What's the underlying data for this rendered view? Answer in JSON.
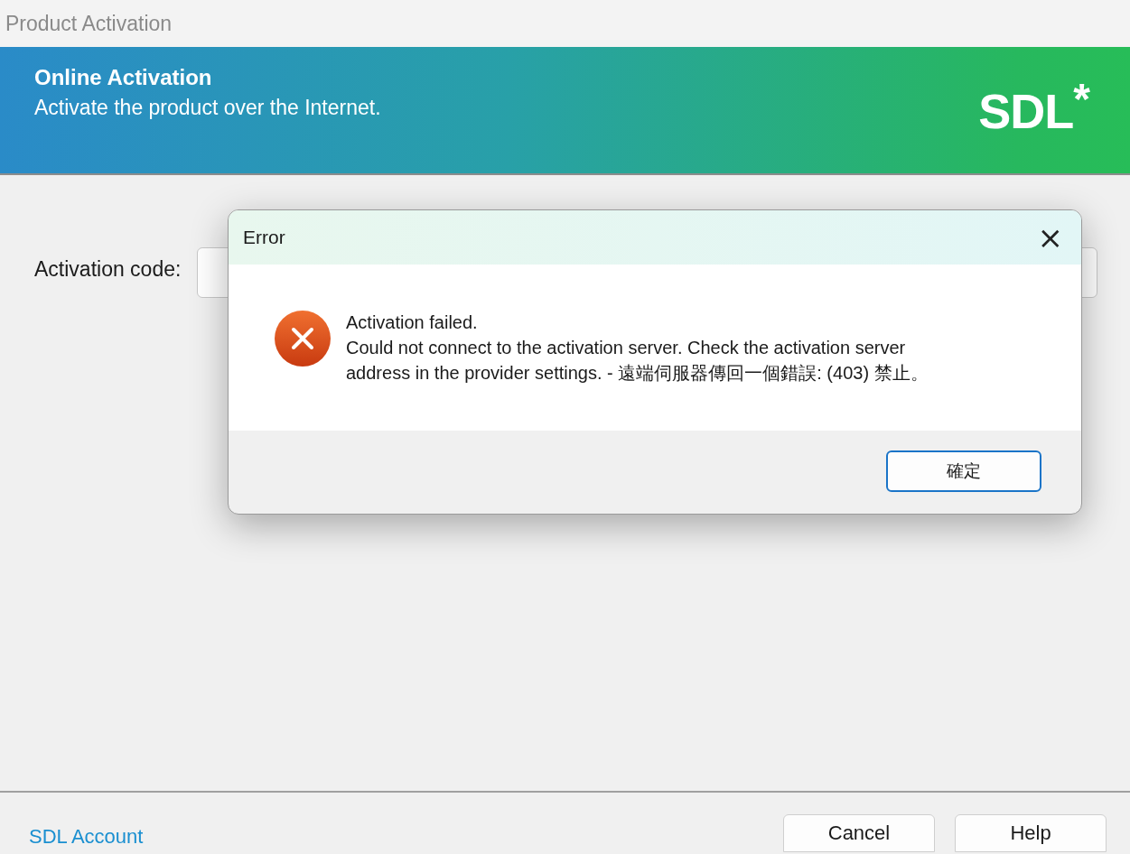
{
  "window": {
    "title": "Product Activation"
  },
  "header": {
    "title": "Online Activation",
    "subtitle": "Activate the product over the Internet.",
    "logo": {
      "text": "SDL",
      "mark": "*"
    }
  },
  "form": {
    "label": "Activation code:"
  },
  "dialog": {
    "title": "Error",
    "close": "×",
    "icon": {
      "kind": "error"
    },
    "lines": [
      "Activation failed.",
      "Could not connect to the activation server. Check the activation server address in the provider settings. - 遠端伺服器傳回一個錯誤: (403) 禁止。"
    ],
    "button": "確定"
  },
  "footer": {
    "link": "SDL Account",
    "buttons": [
      "Cancel",
      "Help"
    ]
  }
}
